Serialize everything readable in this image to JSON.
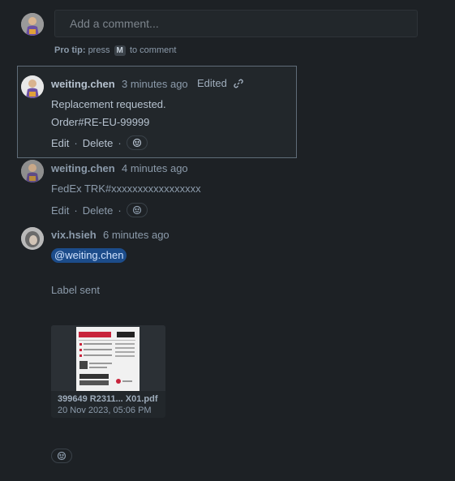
{
  "composer": {
    "placeholder": "Add a comment...",
    "protip_label": "Pro tip:",
    "protip_pre": "press",
    "protip_key": "M",
    "protip_post": "to comment"
  },
  "comments": [
    {
      "author": "weiting.chen",
      "time": "3 minutes ago",
      "edited": "Edited",
      "lines": [
        "Replacement requested.",
        "Order#RE-EU-99999"
      ],
      "actions": [
        "Edit",
        "Delete"
      ],
      "highlighted": true
    },
    {
      "author": "weiting.chen",
      "time": "4 minutes ago",
      "lines": [
        "FedEx TRK#xxxxxxxxxxxxxxxxx"
      ],
      "actions": [
        "Edit",
        "Delete"
      ]
    },
    {
      "author": "vix.hsieh",
      "time": "6 minutes ago",
      "mention": "@weiting.chen",
      "lines": [
        "Label sent"
      ],
      "attachment": {
        "filename": "399649 R2311... X01.pdf",
        "date": "20 Nov 2023, 05:06 PM"
      }
    }
  ],
  "icons": {
    "link": "link-icon",
    "emoji": "add-reaction-icon"
  }
}
